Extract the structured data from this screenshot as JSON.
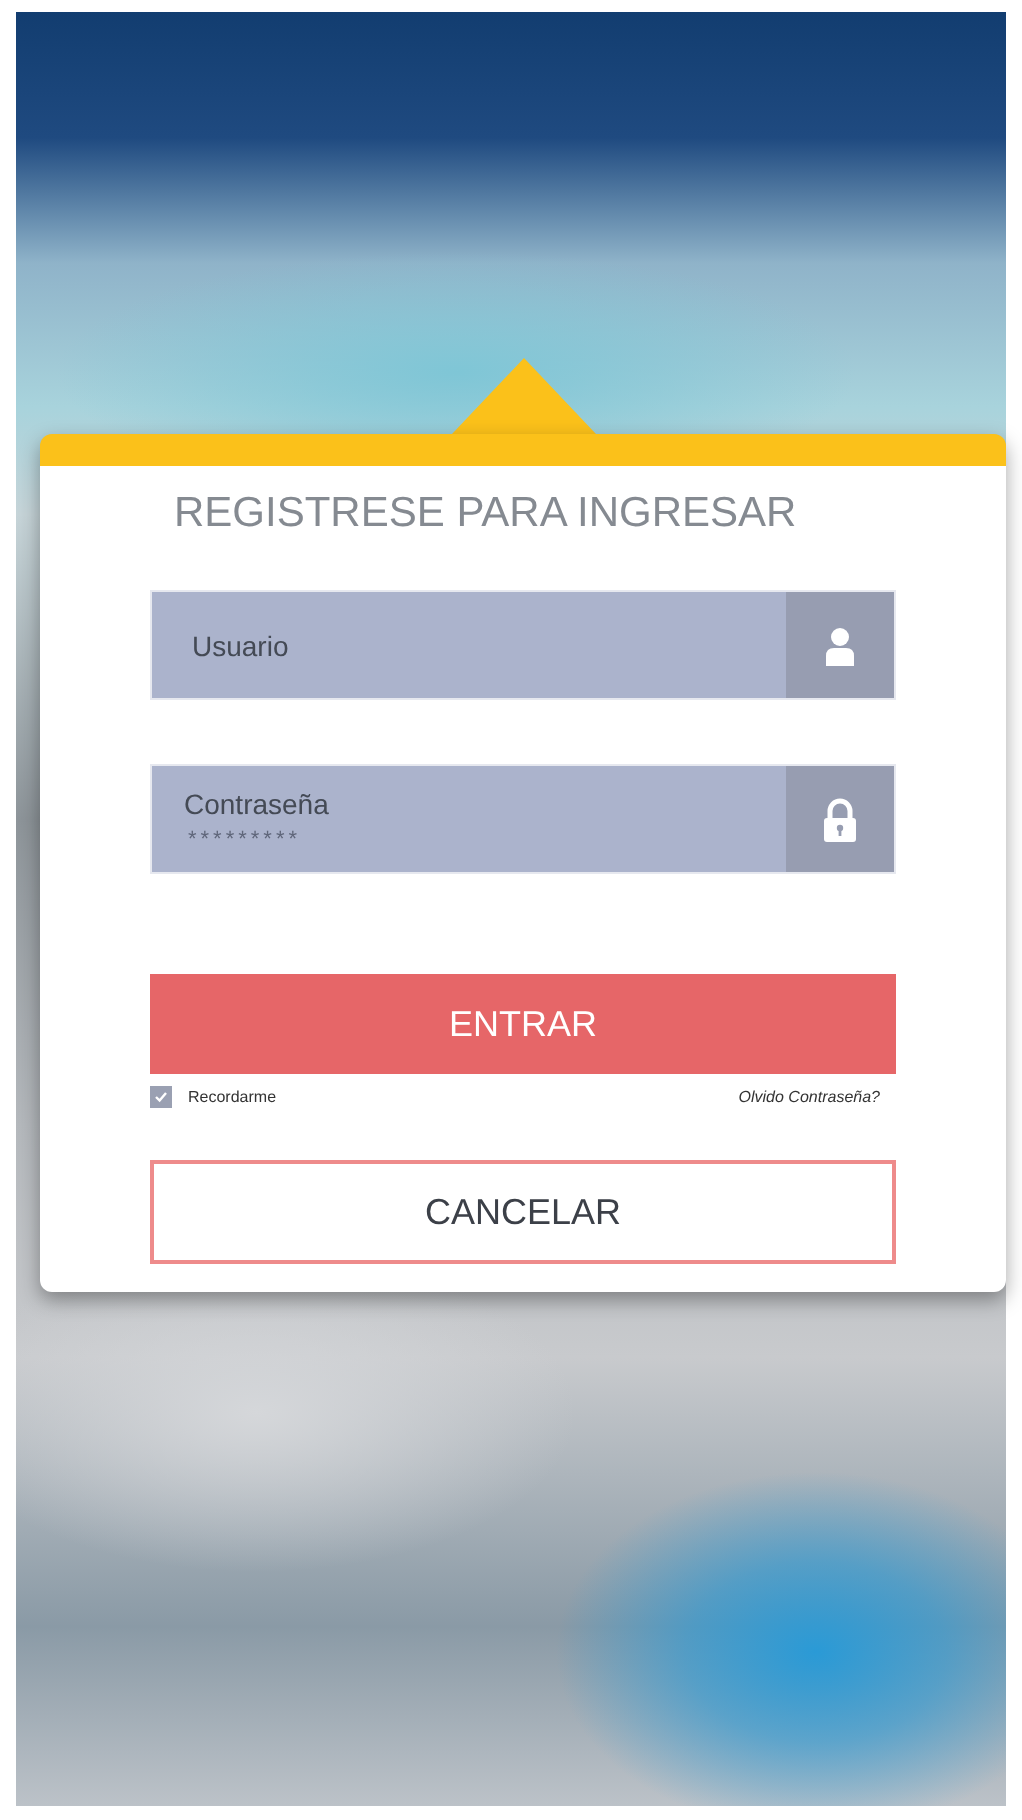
{
  "title": "REGISTRESE PARA INGRESAR",
  "username": {
    "placeholder": "Usuario"
  },
  "password": {
    "label": "Contraseña",
    "value": "*********"
  },
  "submit": "ENTRAR",
  "remember": {
    "label": "Recordarme",
    "checked": true
  },
  "forgot": "Olvido Contraseña?",
  "cancel": "CANCELAR"
}
